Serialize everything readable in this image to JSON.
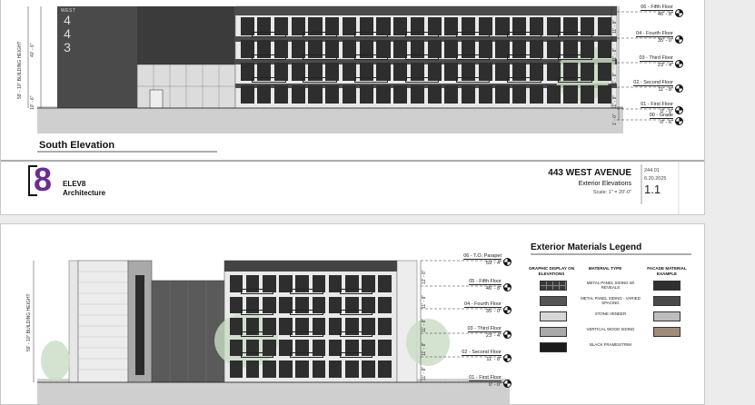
{
  "sheet1": {
    "elevation_title": "South Elevation",
    "building_sign": {
      "word": "WEST",
      "digits": [
        "4",
        "4",
        "3"
      ]
    },
    "dims": {
      "overall": "59' - 10\" BUILDING HEIGHT",
      "upper": "40' - 6\"",
      "lower": "10' - 6\""
    },
    "levels": [
      {
        "name": "06 - Fifth Floor",
        "elev": "46' - 8\""
      },
      {
        "name": "04 - Fourth Floor",
        "elev": "35' - 0\""
      },
      {
        "name": "03 - Third Floor",
        "elev": "23' - 4\""
      },
      {
        "name": "02 - Second Floor",
        "elev": "11' - 8\""
      },
      {
        "name": "01 - First Floor",
        "elev": "0' - 0\""
      },
      {
        "name": "00 - Grade",
        "elev": "-0' - 6\""
      }
    ],
    "vert_dims": [
      "11' - 8\"",
      "11' - 8\"",
      "11' - 8\"",
      "11' - 8\"",
      "1' - 0\""
    ],
    "titleblock": {
      "logo_mark": "8",
      "firm_line1": "ELEV8",
      "firm_line2": "Architecture",
      "project": "443 WEST AVENUE",
      "sheet_title": "Exterior Elevations",
      "scale": "Scale: 1\" = 20'-0\"",
      "job_no": "244.01",
      "date": "6.20.2025",
      "sheet_no": "1.1"
    }
  },
  "sheet2": {
    "overall_dim": "59' - 10\" BUILDING HEIGHT",
    "levels": [
      {
        "name": "06 - T.O. Parapet",
        "elev": "59' - 4\""
      },
      {
        "name": "05 - Fifth Floor",
        "elev": "46' - 8\""
      },
      {
        "name": "04 - Fourth Floor",
        "elev": "35' - 0\""
      },
      {
        "name": "03 - Third Floor",
        "elev": "23' - 4\""
      },
      {
        "name": "02 - Second Floor",
        "elev": "11' - 8\""
      },
      {
        "name": "01 - First Floor",
        "elev": "0' - 0\""
      }
    ],
    "vert_dims": [
      "12' - 8\"",
      "11' - 8\"",
      "11' - 8\"",
      "11' - 8\"",
      "11' - 8\""
    ],
    "legend": {
      "title": "Exterior Materials Legend",
      "col1": "GRAPHIC DISPLAY ON ELEVATIONS",
      "col2": "MATERIAL TYPE",
      "col3": "FACADE MATERIAL EXAMPLE",
      "items": [
        {
          "name": "METAL PANEL SIDING W/ REVEALS",
          "display": "#3a3a3a",
          "example": "#2f2f2f"
        },
        {
          "name": "METAL PANEL SIDING - VARIED SPACING",
          "display": "#555555",
          "example": "#4a4a4a"
        },
        {
          "name": "STONE VENEER",
          "display": "#d6d6d6",
          "example": "#bdbdbd"
        },
        {
          "name": "VERTICAL WOOD SIDING",
          "display": "#a9a9a9",
          "example": "#a08b76"
        },
        {
          "name": "BLACK FRAMES/TRIM",
          "display": "#1c1c1c",
          "example": ""
        }
      ]
    }
  }
}
